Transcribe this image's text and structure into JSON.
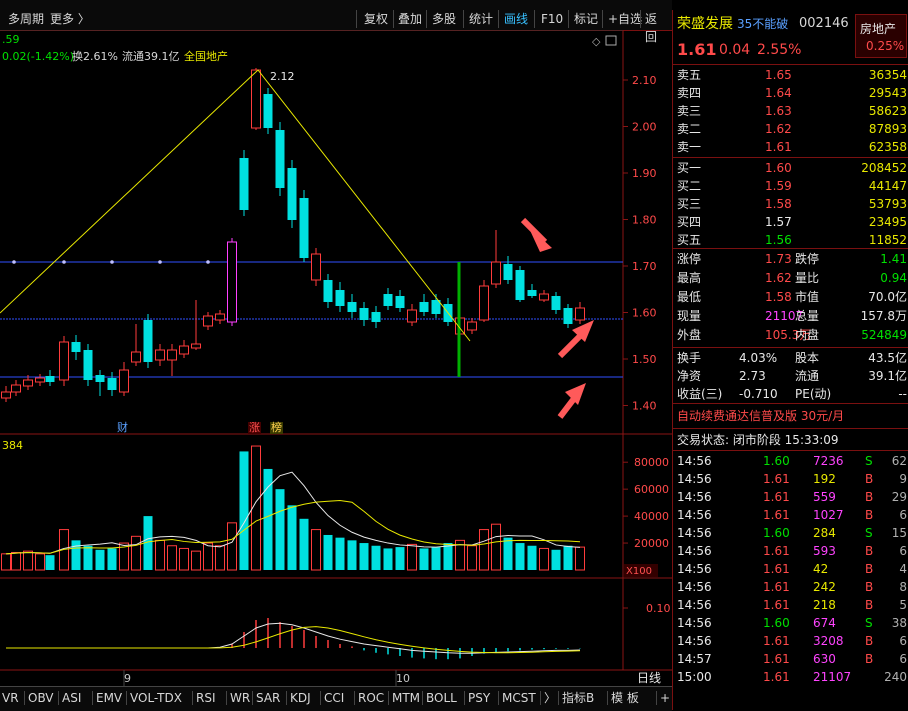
{
  "toolbar": {
    "left": [
      "多周期",
      "更多 〉"
    ],
    "right": [
      "复权",
      "叠加",
      "多股",
      "统计",
      "画线",
      "F10",
      "标记",
      "+自选",
      "返回"
    ],
    "active": "画线"
  },
  "chart": {
    "info_line": {
      "change": "0.02(-1.42%)",
      "turnover": "换2.61%",
      "float": "流通39.1亿",
      "sector": "全国地产",
      "top_fragment": ".59"
    },
    "price_axis": [
      "2.10",
      "2.00",
      "1.90",
      "1.80",
      "1.70",
      "1.60",
      "1.50",
      "1.40"
    ],
    "high_label": "2.12",
    "markers": {
      "cai": "财",
      "zhang": "涨",
      "bang": "榜"
    },
    "volume_label": "384",
    "volume_axis": [
      "80000",
      "60000",
      "40000",
      "20000"
    ],
    "volume_unit": "X100",
    "macd_axis": [
      "0.10"
    ],
    "month_labels": [
      "9",
      "10"
    ],
    "period_label": "日线",
    "colors": {
      "up": "#ff3c3c",
      "down": "#00e0e0",
      "line": "#e8e800",
      "hline": "#3050ff",
      "arrow": "#ff5050"
    }
  },
  "tabs": [
    "VR",
    "OBV",
    "ASI",
    "EMV",
    "VOL-TDX",
    "RSI",
    "WR",
    "SAR",
    "KDJ",
    "CCI",
    "ROC",
    "MTM",
    "BOLL",
    "PSY",
    "MCST",
    "〉",
    "指标B",
    "模 板",
    "+",
    "−"
  ],
  "panel": {
    "name": "荣盛发展",
    "notice": "35不能破",
    "code": "002146",
    "sector": "房地产",
    "sector_pct": "0.25%",
    "price": "1.61",
    "change": "0.04",
    "change_pct": "2.55%",
    "asks": [
      {
        "label": "卖五",
        "price": "1.65",
        "vol": "36354"
      },
      {
        "label": "卖四",
        "price": "1.64",
        "vol": "29543"
      },
      {
        "label": "卖三",
        "price": "1.63",
        "vol": "58623"
      },
      {
        "label": "卖二",
        "price": "1.62",
        "vol": "87893"
      },
      {
        "label": "卖一",
        "price": "1.61",
        "vol": "62358"
      }
    ],
    "bids": [
      {
        "label": "买一",
        "price": "1.60",
        "vol": "208452"
      },
      {
        "label": "买二",
        "price": "1.59",
        "vol": "44147"
      },
      {
        "label": "买三",
        "price": "1.58",
        "vol": "53793"
      },
      {
        "label": "买四",
        "price": "1.57",
        "vol": "23495"
      },
      {
        "label": "买五",
        "price": "1.56",
        "vol": "11852"
      }
    ],
    "stats": [
      {
        "l1": "涨停",
        "v1": "1.73",
        "l2": "跌停",
        "v2": "1.41"
      },
      {
        "l1": "最高",
        "v1": "1.62",
        "l2": "量比",
        "v2": "0.94"
      },
      {
        "l1": "最低",
        "v1": "1.58",
        "l2": "市值",
        "v2": "70.0亿"
      },
      {
        "l1": "现量",
        "v1": "21107",
        "l2": "总量",
        "v2": "157.8万"
      },
      {
        "l1": "外盘",
        "v1": "105.3万",
        "l2": "内盘",
        "v2": "524849"
      }
    ],
    "fund": [
      {
        "l1": "换手",
        "v1": "4.03%",
        "l2": "股本",
        "v2": "43.5亿"
      },
      {
        "l1": "净资",
        "v1": "2.73",
        "l2": "流通",
        "v2": "39.1亿"
      },
      {
        "l1": "收益(三)",
        "v1": "-0.710",
        "l2": "PE(动)",
        "v2": "--"
      }
    ],
    "promo": "自动续费通达信普及版 30元/月",
    "status": "交易状态: 闭市阶段 15:33:09",
    "ticks": [
      {
        "t": "14:56",
        "p": "1.60",
        "v": "7236",
        "d": "S",
        "n": "62"
      },
      {
        "t": "14:56",
        "p": "1.61",
        "v": "192",
        "d": "B",
        "n": "9"
      },
      {
        "t": "14:56",
        "p": "1.61",
        "v": "559",
        "d": "B",
        "n": "29"
      },
      {
        "t": "14:56",
        "p": "1.61",
        "v": "1027",
        "d": "B",
        "n": "6"
      },
      {
        "t": "14:56",
        "p": "1.60",
        "v": "284",
        "d": "S",
        "n": "15"
      },
      {
        "t": "14:56",
        "p": "1.61",
        "v": "593",
        "d": "B",
        "n": "6"
      },
      {
        "t": "14:56",
        "p": "1.61",
        "v": "42",
        "d": "B",
        "n": "4"
      },
      {
        "t": "14:56",
        "p": "1.61",
        "v": "242",
        "d": "B",
        "n": "8"
      },
      {
        "t": "14:56",
        "p": "1.61",
        "v": "218",
        "d": "B",
        "n": "5"
      },
      {
        "t": "14:56",
        "p": "1.60",
        "v": "674",
        "d": "S",
        "n": "38"
      },
      {
        "t": "14:56",
        "p": "1.61",
        "v": "3208",
        "d": "B",
        "n": "6"
      },
      {
        "t": "14:57",
        "p": "1.61",
        "v": "630",
        "d": "B",
        "n": "6"
      },
      {
        "t": "15:00",
        "p": "1.61",
        "v": "21107",
        "d": "",
        "n": "240"
      }
    ]
  }
}
